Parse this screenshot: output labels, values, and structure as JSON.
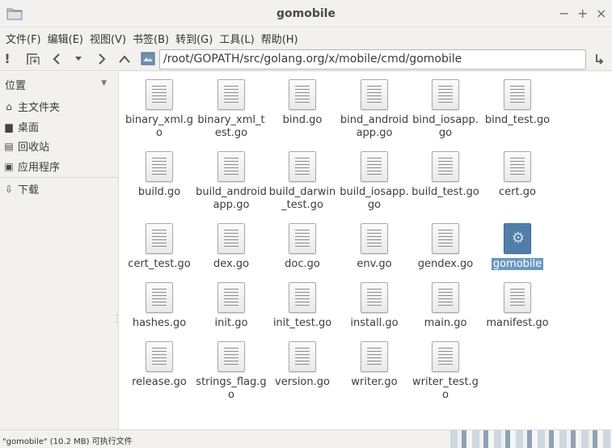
{
  "window": {
    "title": "gomobile",
    "controls": {
      "minimize": "−",
      "maximize": "+",
      "close": "×"
    }
  },
  "menubar": [
    "文件(F)",
    "编辑(E)",
    "视图(V)",
    "书签(B)",
    "转到(G)",
    "工具(L)",
    "帮助(H)"
  ],
  "toolbar": {
    "path": "/root/GOPATH/src/golang.org/x/mobile/cmd/gomobile"
  },
  "sidebar": {
    "header": "位置",
    "items": [
      {
        "label": "主文件夹",
        "icon": "home-icon"
      },
      {
        "label": "桌面",
        "icon": "desktop-icon"
      },
      {
        "label": "回收站",
        "icon": "trash-icon"
      },
      {
        "label": "应用程序",
        "icon": "applications-icon"
      },
      {
        "label": "下载",
        "icon": "download-icon"
      }
    ]
  },
  "files": [
    {
      "name": "binary_xml.go"
    },
    {
      "name": "binary_xml_test.go"
    },
    {
      "name": "bind.go"
    },
    {
      "name": "bind_androidapp.go"
    },
    {
      "name": "bind_iosapp.go"
    },
    {
      "name": "bind_test.go"
    },
    {
      "name": "build.go"
    },
    {
      "name": "build_androidapp.go"
    },
    {
      "name": "build_darwin_test.go"
    },
    {
      "name": "build_iosapp.go"
    },
    {
      "name": "build_test.go"
    },
    {
      "name": "cert.go"
    },
    {
      "name": "cert_test.go"
    },
    {
      "name": "dex.go"
    },
    {
      "name": "doc.go"
    },
    {
      "name": "env.go"
    },
    {
      "name": "gendex.go"
    },
    {
      "name": "gomobile",
      "selected": true
    },
    {
      "name": "hashes.go"
    },
    {
      "name": "init.go"
    },
    {
      "name": "init_test.go"
    },
    {
      "name": "install.go"
    },
    {
      "name": "main.go"
    },
    {
      "name": "manifest.go"
    },
    {
      "name": "release.go"
    },
    {
      "name": "strings_flag.go"
    },
    {
      "name": "version.go"
    },
    {
      "name": "writer.go"
    },
    {
      "name": "writer_test.go"
    }
  ],
  "status": {
    "text": "\"gomobile\" (10.2 MB) 可执行文件"
  },
  "colors": {
    "selection": "#6a98c2",
    "chrome": "#f2f1f0"
  }
}
